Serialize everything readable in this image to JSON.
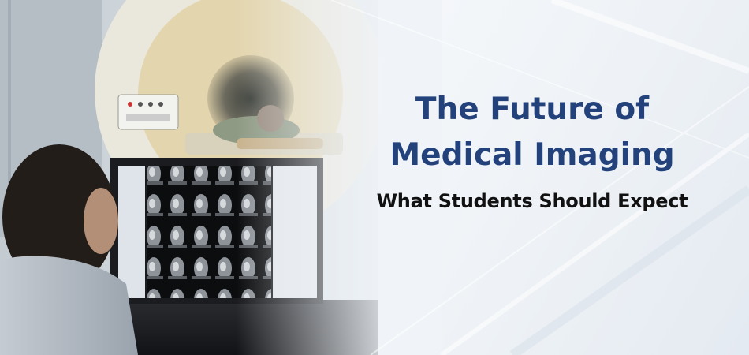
{
  "headline": {
    "title_line1": "The Future of",
    "title_line2": "Medical Imaging",
    "subtitle": "What Students Should Expect"
  },
  "colors": {
    "title": "#23427c",
    "subtitle": "#111111",
    "background": "#eef2f6"
  }
}
